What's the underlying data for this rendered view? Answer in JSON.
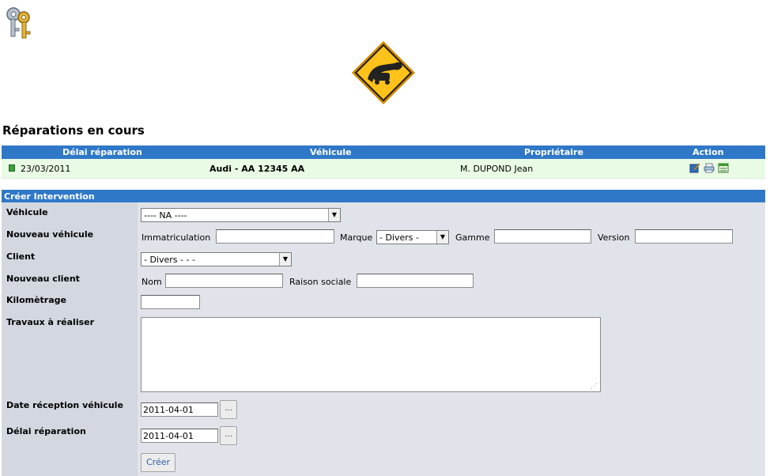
{
  "page": {
    "title": "Réparations en cours"
  },
  "repairs_table": {
    "headers": [
      "Délai réparation",
      "Véhicule",
      "Propriétaire",
      "Action"
    ],
    "rows": [
      {
        "delai": "23/03/2011",
        "vehicule": "Audi - AA 12345 AA",
        "proprietaire": "M. DUPOND Jean",
        "actions": [
          "edit-icon",
          "print-icon",
          "close-repair-icon"
        ]
      }
    ]
  },
  "form": {
    "title": "Créer Intervention",
    "vehicule": {
      "label": "Véhicule",
      "selected": "---- NA ----"
    },
    "nouveau_vehicule": {
      "label": "Nouveau véhicule",
      "immatriculation_label": "Immatriculation",
      "immatriculation_value": "",
      "marque_label": "Marque",
      "marque_selected": "- Divers -",
      "gamme_label": "Gamme",
      "gamme_value": "",
      "version_label": "Version",
      "version_value": ""
    },
    "client": {
      "label": "Client",
      "selected": "- Divers - - -"
    },
    "nouveau_client": {
      "label": "Nouveau client",
      "nom_label": "Nom",
      "nom_value": "",
      "raison_label": "Raison sociale",
      "raison_value": ""
    },
    "kilometrage": {
      "label": "Kilomètrage",
      "value": ""
    },
    "travaux": {
      "label": "Travaux à réaliser",
      "value": ""
    },
    "date_reception": {
      "label": "Date réception véhicule",
      "value": "2011-04-01",
      "button": "..."
    },
    "delai_reparation": {
      "label": "Délai réparation",
      "value": "2011-04-01",
      "button": "..."
    },
    "submit_label": "Créer"
  },
  "colors": {
    "header_blue": "#2f78c8",
    "row_green": "#e9fbe4",
    "label_col": "#d3d8e0",
    "form_bg": "#e0e4ea"
  }
}
